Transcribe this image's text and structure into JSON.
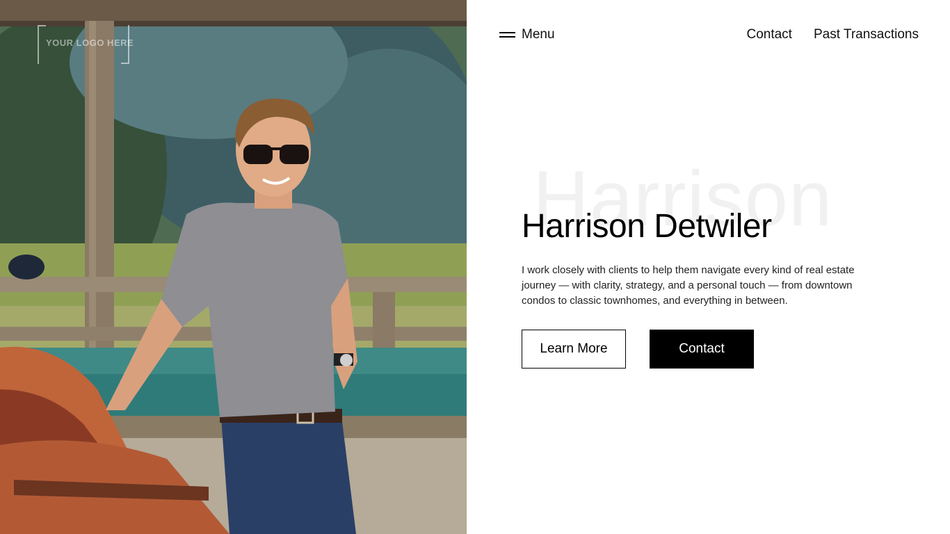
{
  "logo": {
    "text": "YOUR LOGO HERE"
  },
  "nav": {
    "menu_label": "Menu",
    "menu_icon": "hamburger-icon",
    "links": [
      "Contact",
      "Past Transactions"
    ]
  },
  "hero": {
    "watermark": "Harrison",
    "title": "Harrison Detwiler",
    "description": "I work closely with clients to help them navigate every kind of real estate journey — with clarity, strategy, and a personal touch — from downtown condos to classic townhomes, and everything in between.",
    "primary_button": "Learn More",
    "secondary_button": "Contact"
  },
  "colors": {
    "background": "#ffffff",
    "text": "#000000",
    "watermark": "#f1f1f1",
    "button_solid": "#000000"
  }
}
